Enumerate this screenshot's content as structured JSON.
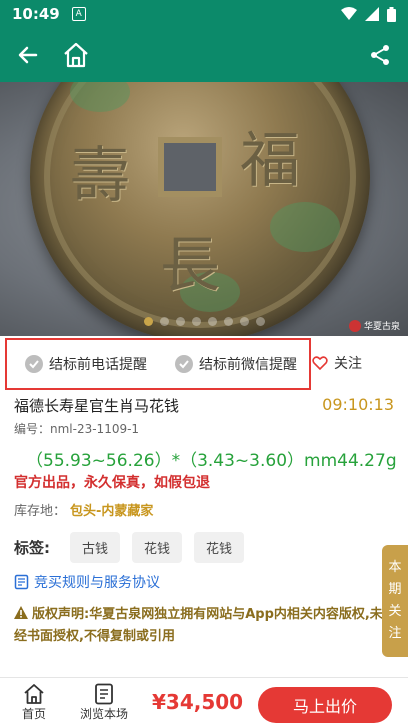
{
  "status": {
    "time": "10:49",
    "notif_glyph": "A"
  },
  "topbar": {
    "back_icon": "arrow-left-icon",
    "home_icon": "home-icon",
    "share_icon": "share-icon"
  },
  "gallery": {
    "page_count": 8,
    "active_index": 0
  },
  "reminders": {
    "phone": "结标前电话提醒",
    "wechat": "结标前微信提醒",
    "follow": "关注"
  },
  "item": {
    "title": "福德长寿星官生肖马花钱",
    "timer": "09:10:13",
    "code": "编号：nml-23-1109-1",
    "size": "（55.93~56.26）*（3.43~3.60）mm44.27g",
    "guarantee": "官方出品，永久保真，如假包退",
    "storage_label": "库存地：",
    "storage_value": "包头-内蒙藏家"
  },
  "tags": {
    "label": "标签:",
    "items": [
      "古钱",
      "花钱",
      "花钱"
    ]
  },
  "rules": "竞买规则与服务协议",
  "copyright": "版权声明:华夏古泉网独立拥有网站与App内相关内容版权,未经书面授权,不得复制或引用",
  "side_follow": [
    "本",
    "期",
    "关",
    "注"
  ],
  "bottom": {
    "home": "首页",
    "browse": "浏览本场",
    "price": "¥34,500",
    "bid": "马上出价"
  },
  "colors": {
    "brand": "#0c8a6a",
    "accent": "#c8961e",
    "red": "#e53935"
  }
}
